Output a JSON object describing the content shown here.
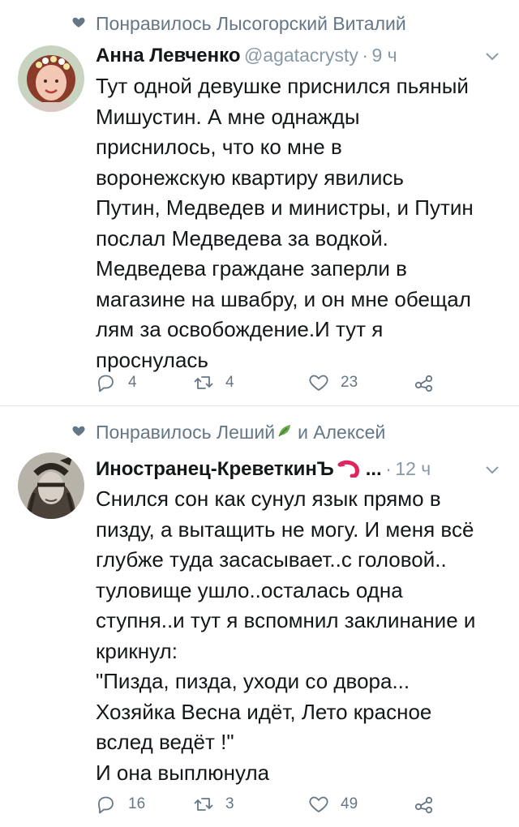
{
  "tweets": [
    {
      "social_context": "Понравилось Лысогорский Виталий",
      "author_name": "Анна Левченко",
      "handle": "@agatacrysty",
      "separator": "·",
      "time": "9 ч",
      "text": "Тут одной девушке приснился пьяный\nМишустин. А мне однажды\nприснилось, что ко мне в\nворонежскую квартиру явились\nПутин, Медведев и министры, и Путин\nпослал Медведева за водкой.\nМедведева граждане заперли в\nмагазине на швабру, и он мне обещал\nлям за освобождение.И тут я\nпроснулась",
      "replies": "4",
      "retweets": "4",
      "likes": "23"
    },
    {
      "social_context_a": "Понравилось Леший",
      "social_context_b": "и Алексей",
      "author_name": "Иностранец-КреветкинЪ",
      "ellipsis": "...",
      "separator": "·",
      "time": "12 ч",
      "text": "Снился сон как сунул язык прямо в\nпизду, а вытащить не могу. И меня всё\nглубже туда засасывает..с головой..\nтуловище ушло..осталась одна\nступня..и тут я вспомнил заклинание и\nкрикнул:\n\"Пизда, пизда, уходи со двора...\nХозяйка Весна идёт, Лето красное\nвслед ведёт !\"\nИ она выплюнула",
      "replies": "16",
      "retweets": "3",
      "likes": "49"
    }
  ],
  "icons": {
    "social_heart": "heart-icon",
    "leaf": "leaf-icon",
    "emoji": "shrimp-icon",
    "chevron": "chevron-down-icon",
    "reply": "reply-icon",
    "retweet": "retweet-icon",
    "like": "like-icon",
    "share": "share-icon"
  },
  "colors": {
    "text": "#14171a",
    "secondary": "#657786",
    "muted": "#8899a6",
    "divider": "#e1e8ed",
    "leaf": "#6aa84f",
    "shrimp": "#e0245e"
  }
}
